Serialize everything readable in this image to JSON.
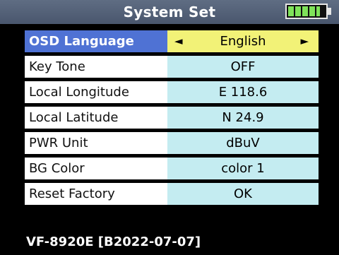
{
  "header": {
    "title": "System Set",
    "battery_level": 0.8,
    "battery_color": "#7fe25a"
  },
  "menu": {
    "items": [
      {
        "label": "OSD Language",
        "value": "English",
        "selected": true
      },
      {
        "label": "Key Tone",
        "value": "OFF"
      },
      {
        "label": "Local Longitude",
        "value": "E 118.6"
      },
      {
        "label": "Local Latitude",
        "value": "N 24.9"
      },
      {
        "label": "PWR Unit",
        "value": "dBuV"
      },
      {
        "label": "BG Color",
        "value": "color 1"
      },
      {
        "label": "Reset Factory",
        "value": "OK"
      }
    ],
    "arrow_left": "◄",
    "arrow_right": "►"
  },
  "footer": {
    "model": "VF-8920E [B2022-07-07]"
  },
  "colors": {
    "selected_label_bg": "#4f72d4",
    "selected_value_bg": "#f2f277",
    "value_bg": "#c4ecf1"
  }
}
